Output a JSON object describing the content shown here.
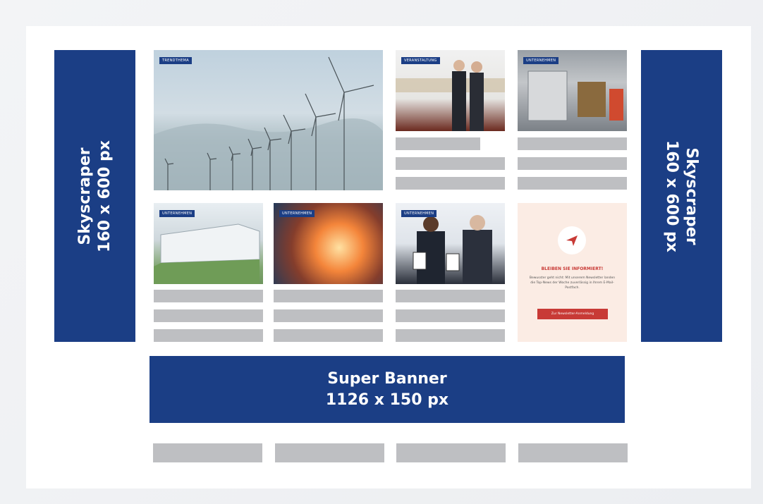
{
  "ads": {
    "skyscraper_left": {
      "line1": "Skyscraper",
      "line2": "160 x 600 px"
    },
    "skyscraper_right": {
      "line1": "Skyscraper",
      "line2": "160 x 600 px"
    },
    "super_banner": {
      "line1": "Super Banner",
      "line2": "1126 x 150 px"
    }
  },
  "tiles": {
    "wind": {
      "tag": "TRENDTHEMA"
    },
    "event": {
      "tag": "VERANSTALTUNG"
    },
    "machine": {
      "tag": "UNTERNEHMEN"
    },
    "building": {
      "tag": "UNTERNEHMEN"
    },
    "furnace": {
      "tag": "UNTERNEHMEN"
    },
    "people": {
      "tag": "UNTERNEHMEN"
    }
  },
  "newsletter": {
    "icon": "paper-plane-icon",
    "title": "BLEIBEN SIE INFORMIERT!",
    "body": "Bewusster geht nicht: Mit unserem Newsletter landen die Top-News der Woche zuverlässig in Ihrem E-Mail-Postfach.",
    "button": "Zur Newsletter-Anmeldung"
  },
  "colors": {
    "brand": "#1b3e85",
    "placeholder": "#bebfc2",
    "accent": "#c83a36"
  }
}
